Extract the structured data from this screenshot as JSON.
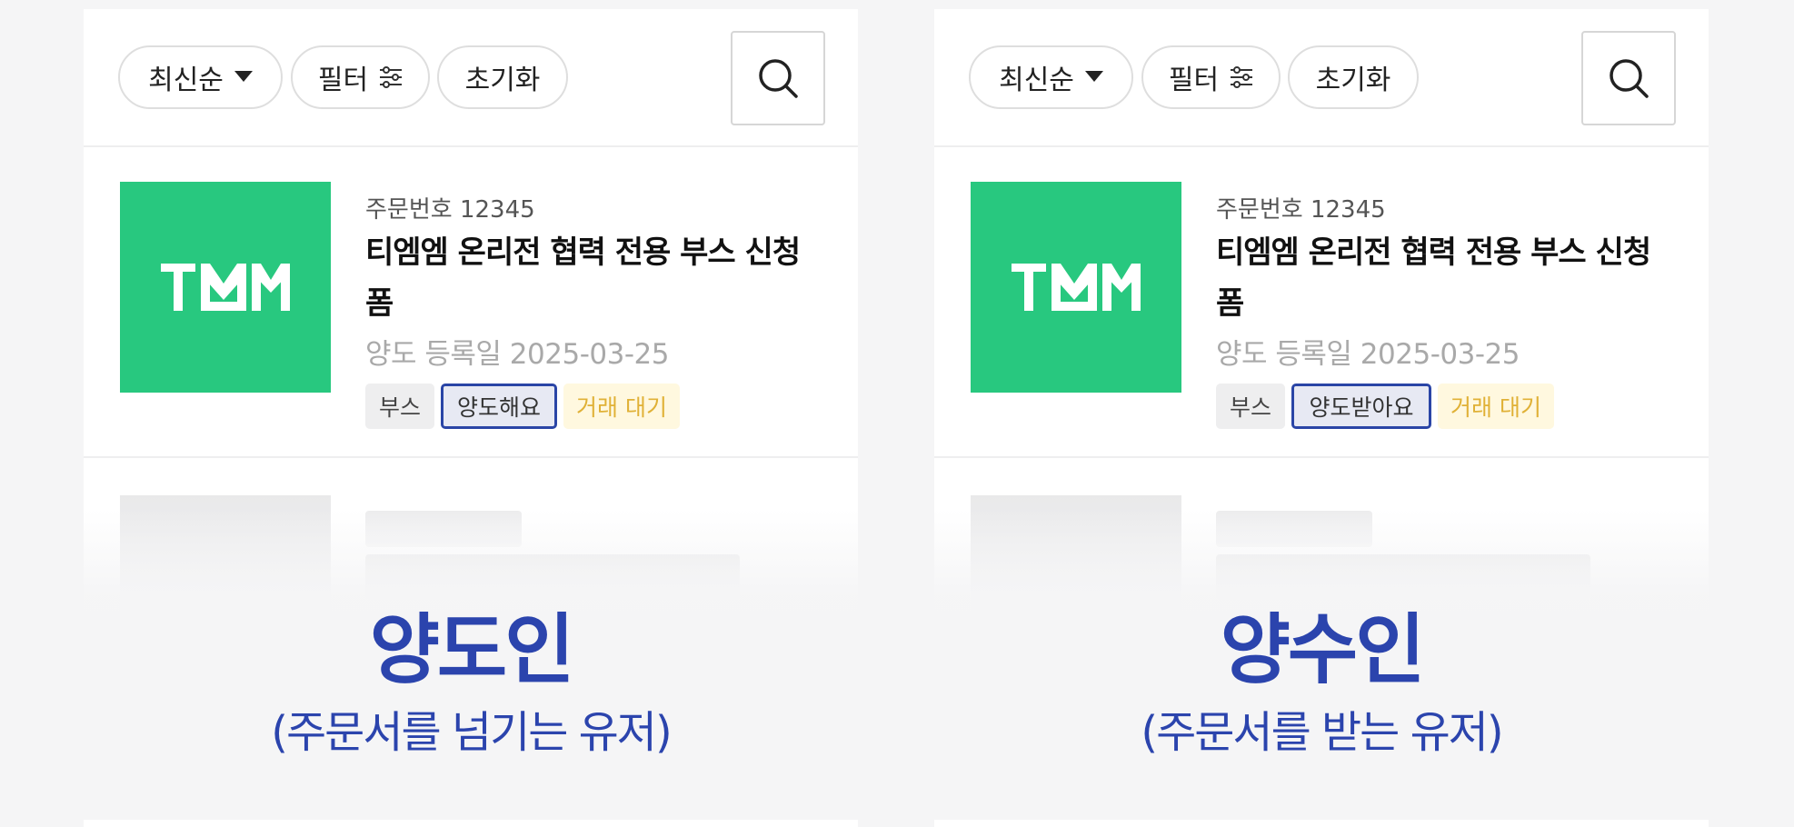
{
  "panels": [
    {
      "toolbar": {
        "sort_label": "최신순",
        "filter_label": "필터",
        "reset_label": "초기화"
      },
      "item": {
        "order_no": "주문번호 12345",
        "title": "티엠엠 온리전 협력 전용 부스 신청 폼",
        "reg_date": "양도 등록일 2025-03-25",
        "tags": [
          "부스",
          "양도해요",
          "거래 대기"
        ],
        "logo_text": "TMM"
      },
      "role_title": "양도인",
      "role_subtitle": "(주문서를 넘기는 유저)"
    },
    {
      "toolbar": {
        "sort_label": "최신순",
        "filter_label": "필터",
        "reset_label": "초기화"
      },
      "item": {
        "order_no": "주문번호 12345",
        "title": "티엠엠 온리전 협력 전용 부스 신청 폼",
        "reg_date": "양도 등록일 2025-03-25",
        "tags": [
          "부스",
          "양도받아요",
          "거래 대기"
        ],
        "logo_text": "TMM"
      },
      "role_title": "양수인",
      "role_subtitle": "(주문서를 받는 유저)"
    }
  ],
  "icons": {
    "sort": "caret-down-icon",
    "filter": "sliders-icon",
    "search": "search-icon"
  },
  "colors": {
    "brand_green": "#28c87f",
    "role_blue": "#2b44ad",
    "status_yellow": "#e0b136",
    "status_bg": "#fff8df",
    "tag_border": "#2a45a6"
  }
}
